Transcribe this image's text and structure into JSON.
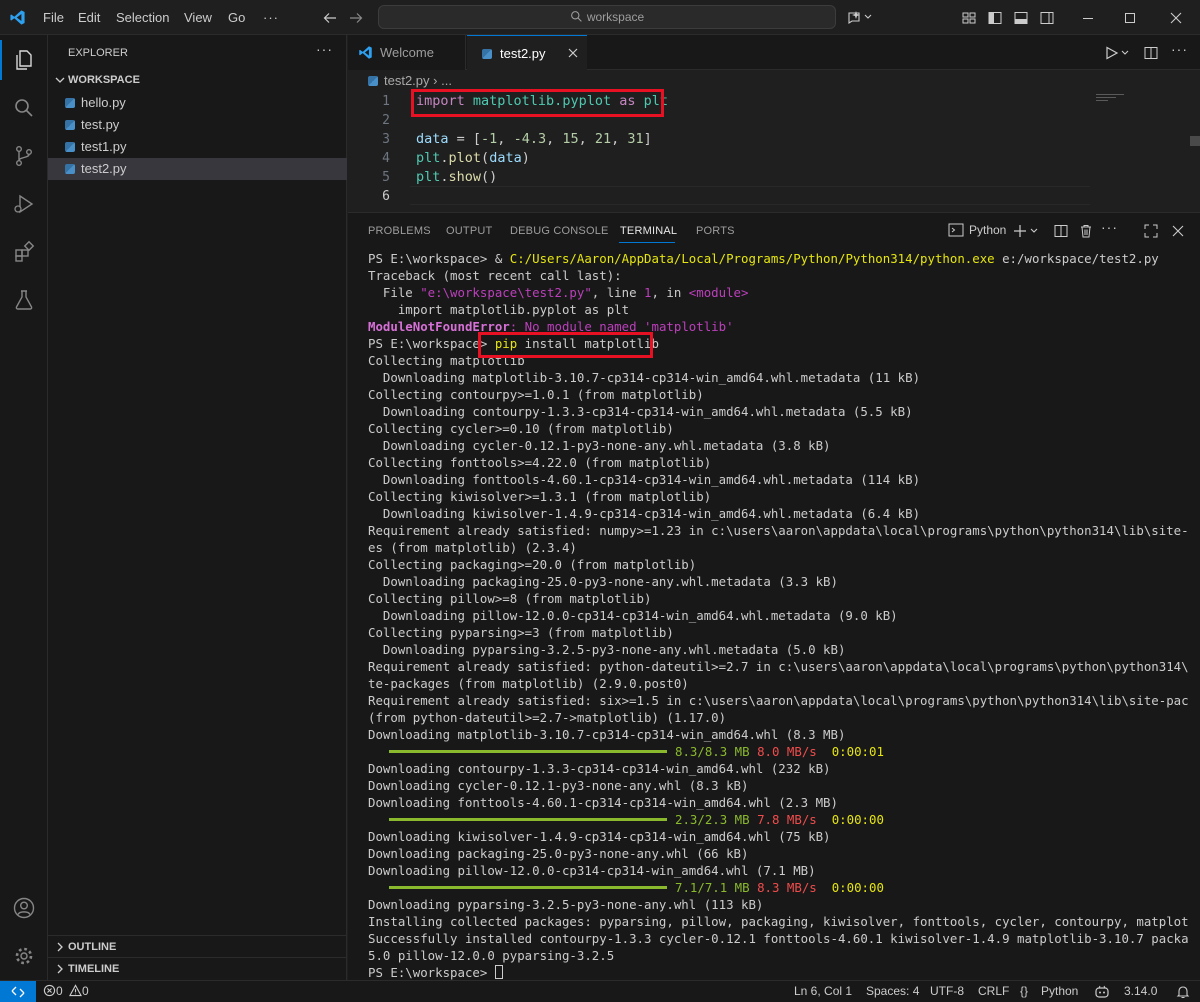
{
  "titlebar": {
    "menu": [
      "File",
      "Edit",
      "Selection",
      "View",
      "Go"
    ],
    "more": "···",
    "search_placeholder": "workspace"
  },
  "sidebar": {
    "title": "EXPLORER",
    "more": "···",
    "workspace": "WORKSPACE",
    "files": [
      "hello.py",
      "test.py",
      "test1.py",
      "test2.py"
    ],
    "selected": "test2.py",
    "outline": "OUTLINE",
    "timeline": "TIMELINE"
  },
  "editor": {
    "tabs": [
      {
        "label": "Welcome",
        "active": false
      },
      {
        "label": "test2.py",
        "active": true
      }
    ],
    "breadcrumb": {
      "file": "test2.py",
      "sep": "›",
      "rest": "..."
    },
    "line_numbers": [
      "1",
      "2",
      "3",
      "4",
      "5",
      "6"
    ],
    "code": {
      "l1_kw": "import",
      "l1_mod": " matplotlib.pyplot ",
      "l1_as": "as",
      "l1_alias": " plt",
      "l3_var": "data",
      "l3_eq": " = [",
      "l3_vals": [
        "-1",
        "-4.3",
        "15",
        "21",
        "31"
      ],
      "l3_end": "]",
      "l4_obj": "plt",
      "l4_fn": "plot",
      "l4_arg": "data",
      "l5_obj": "plt",
      "l5_fn": "show"
    }
  },
  "panel": {
    "tabs": [
      "PROBLEMS",
      "OUTPUT",
      "DEBUG CONSOLE",
      "TERMINAL",
      "PORTS"
    ],
    "active_tab": "TERMINAL",
    "shell": "Python",
    "terminal": {
      "l01_a": "PS E:\\workspace> & ",
      "l01_b": "C:/Users/Aaron/AppData/Local/Programs/Python/Python314/python.exe",
      "l01_c": " e:/workspace/test2.py",
      "l02": "Traceback (most recent call last):",
      "l03_a": "  File ",
      "l03_b": "\"e:\\workspace\\test2.py\"",
      "l03_c": ", line ",
      "l03_d": "1",
      "l03_e": ", in ",
      "l03_f": "<module>",
      "l04": "    import matplotlib.pyplot as plt",
      "l05_a": "ModuleNotFoundError",
      "l05_b": ": No module named 'matplotlib'",
      "l06_a": "PS E:\\workspace> ",
      "l06_b": "pip",
      "l06_c": " install matplotlib",
      "l07": "Collecting matplotlib",
      "l08": "  Downloading matplotlib-3.10.7-cp314-cp314-win_amd64.whl.metadata (11 kB)",
      "l09": "Collecting contourpy>=1.0.1 (from matplotlib)",
      "l10": "  Downloading contourpy-1.3.3-cp314-cp314-win_amd64.whl.metadata (5.5 kB)",
      "l11": "Collecting cycler>=0.10 (from matplotlib)",
      "l12": "  Downloading cycler-0.12.1-py3-none-any.whl.metadata (3.8 kB)",
      "l13": "Collecting fonttools>=4.22.0 (from matplotlib)",
      "l14": "  Downloading fonttools-4.60.1-cp314-cp314-win_amd64.whl.metadata (114 kB)",
      "l15": "Collecting kiwisolver>=1.3.1 (from matplotlib)",
      "l16": "  Downloading kiwisolver-1.4.9-cp314-cp314-win_amd64.whl.metadata (6.4 kB)",
      "l17": "Requirement already satisfied: numpy>=1.23 in c:\\users\\aaron\\appdata\\local\\programs\\python\\python314\\lib\\site-packag",
      "l18": "es (from matplotlib) (2.3.4)",
      "l19": "Collecting packaging>=20.0 (from matplotlib)",
      "l20": "  Downloading packaging-25.0-py3-none-any.whl.metadata (3.3 kB)",
      "l21": "Collecting pillow>=8 (from matplotlib)",
      "l22": "  Downloading pillow-12.0.0-cp314-cp314-win_amd64.whl.metadata (9.0 kB)",
      "l23": "Collecting pyparsing>=3 (from matplotlib)",
      "l24": "  Downloading pyparsing-3.2.5-py3-none-any.whl.metadata (5.0 kB)",
      "l25": "Requirement already satisfied: python-dateutil>=2.7 in c:\\users\\aaron\\appdata\\local\\programs\\python\\python314\\lib\\si",
      "l26": "te-packages (from matplotlib) (2.9.0.post0)",
      "l27": "Requirement already satisfied: six>=1.5 in c:\\users\\aaron\\appdata\\local\\programs\\python\\python314\\lib\\site-packages",
      "l28": "(from python-dateutil>=2.7->matplotlib) (1.17.0)",
      "l29": "Downloading matplotlib-3.10.7-cp314-cp314-win_amd64.whl (8.3 MB)",
      "p1_size": "8.3/8.3 MB",
      "p1_speed": "8.0 MB/s",
      "p1_eta": "0:00:01",
      "l31": "Downloading contourpy-1.3.3-cp314-cp314-win_amd64.whl (232 kB)",
      "l32": "Downloading cycler-0.12.1-py3-none-any.whl (8.3 kB)",
      "l33": "Downloading fonttools-4.60.1-cp314-cp314-win_amd64.whl (2.3 MB)",
      "p2_size": "2.3/2.3 MB",
      "p2_speed": "7.8 MB/s",
      "p2_eta": "0:00:00",
      "l35": "Downloading kiwisolver-1.4.9-cp314-cp314-win_amd64.whl (75 kB)",
      "l36": "Downloading packaging-25.0-py3-none-any.whl (66 kB)",
      "l37": "Downloading pillow-12.0.0-cp314-cp314-win_amd64.whl (7.1 MB)",
      "p3_size": "7.1/7.1 MB",
      "p3_speed": "8.3 MB/s",
      "p3_eta": "0:00:00",
      "l39": "Downloading pyparsing-3.2.5-py3-none-any.whl (113 kB)",
      "l40": "Installing collected packages: pyparsing, pillow, packaging, kiwisolver, fonttools, cycler, contourpy, matplotlib",
      "l41": "Successfully installed contourpy-1.3.3 cycler-0.12.1 fonttools-4.60.1 kiwisolver-1.4.9 matplotlib-3.10.7 packaging-2",
      "l42": "5.0 pillow-12.0.0 pyparsing-3.2.5",
      "l43": "PS E:\\workspace> "
    }
  },
  "statusbar": {
    "errors": "0",
    "warnings": "0",
    "position": "Ln 6, Col 1",
    "spaces": "Spaces: 4",
    "encoding": "UTF-8",
    "eol": "CRLF",
    "braces": "{}",
    "language": "Python",
    "version": "3.14.0"
  },
  "colors": {
    "accent": "#0078d4",
    "highlight_box": "#e81123",
    "progress": "#8ab92d"
  }
}
